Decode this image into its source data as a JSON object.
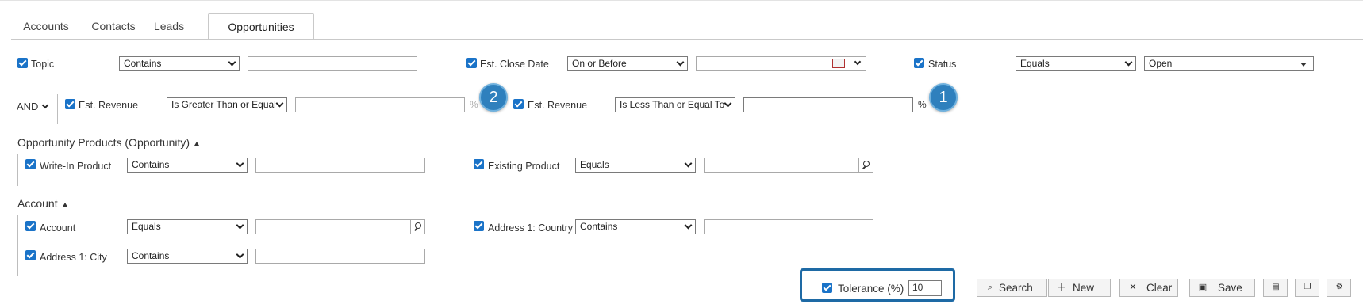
{
  "tabs": [
    {
      "label": "Accounts",
      "active": false
    },
    {
      "label": "Contacts",
      "active": false
    },
    {
      "label": "Leads",
      "active": false
    },
    {
      "label": "Opportunities",
      "active": true
    }
  ],
  "row1": {
    "topic": {
      "label": "Topic",
      "operator": "Contains",
      "value": ""
    },
    "close_date": {
      "label": "Est. Close Date",
      "operator": "On or Before",
      "value": ""
    },
    "status": {
      "label": "Status",
      "operator": "Equals",
      "value": "Open"
    }
  },
  "row2": {
    "logic": "AND",
    "revenue_min": {
      "label": "Est. Revenue",
      "operator": "Is Greater Than or Equal",
      "value": "",
      "unit": "%"
    },
    "revenue_max": {
      "label": "Est. Revenue",
      "operator": "Is Less Than or Equal To",
      "value": "",
      "unit": "%"
    },
    "badge_left": "2",
    "badge_right": "1"
  },
  "sections": {
    "products": {
      "title": "Opportunity Products (Opportunity)",
      "write_in": {
        "label": "Write-In Product",
        "operator": "Contains",
        "value": ""
      },
      "existing": {
        "label": "Existing Product",
        "operator": "Equals",
        "value": ""
      }
    },
    "account": {
      "title": "Account",
      "account": {
        "label": "Account",
        "operator": "Equals",
        "value": ""
      },
      "country": {
        "label": "Address 1: Country",
        "operator": "Contains",
        "value": ""
      },
      "city": {
        "label": "Address 1: City",
        "operator": "Contains",
        "value": ""
      }
    }
  },
  "tolerance": {
    "label": "Tolerance (%)",
    "value": "10"
  },
  "toolbar": {
    "search": "Search",
    "new": "New",
    "clear": "Clear",
    "save": "Save"
  },
  "icons": {
    "search": "search-icon",
    "new": "plus-icon",
    "clear": "x-icon",
    "save": "save-icon"
  },
  "colors": {
    "accent": "#1a73c8",
    "badge": "#2f80bd",
    "highlight_border": "#1e6aa5"
  }
}
